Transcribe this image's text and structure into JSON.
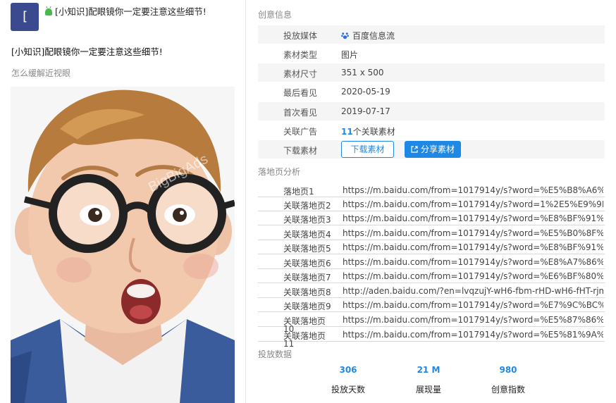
{
  "left": {
    "avatar_char": "[",
    "header_title": "[小知识]配眼镜你一定要注意这些细节!",
    "ad_title": "[小知识]配眼镜你一定要注意这些细节!",
    "ad_desc": "怎么缓解近视眼",
    "watermark": "BigBigAds"
  },
  "creative_info": {
    "section_title": "创意信息",
    "rows": [
      {
        "label": "投放媒体",
        "value": "百度信息流"
      },
      {
        "label": "素材类型",
        "value": "图片"
      },
      {
        "label": "素材尺寸",
        "value": "351 x 500"
      },
      {
        "label": "最后看见",
        "value": "2020-05-19"
      },
      {
        "label": "首次看见",
        "value": "2019-07-17"
      },
      {
        "label": "关联广告",
        "count": "11",
        "suffix": "个关联素材"
      },
      {
        "label": "下载素材"
      }
    ],
    "download_button": "下载素材",
    "share_button": "分享素材"
  },
  "landing": {
    "section_title": "落地页分析",
    "rows": [
      {
        "label": "落地页1",
        "url": "https://m.baidu.com/from=1017914y/s?word=%E5%B8%A6%E7%8..."
      },
      {
        "label": "关联落地页2",
        "url": "https://m.baidu.com/from=1017914y/s?word=1%2E5%E9%9D%92..."
      },
      {
        "label": "关联落地页3",
        "url": "https://m.baidu.com/from=1017914y/s?word=%E8%BF%91%E8%A..."
      },
      {
        "label": "关联落地页4",
        "url": "https://m.baidu.com/from=1017914y/s?word=%E5%B0%8F%E5%A..."
      },
      {
        "label": "关联落地页5",
        "url": "https://m.baidu.com/from=1017914y/s?word=%E8%BF%91%E8%A..."
      },
      {
        "label": "关联落地页6",
        "url": "https://m.baidu.com/from=1017914y/s?word=%E8%A7%86%E5%8..."
      },
      {
        "label": "关联落地页7",
        "url": "https://m.baidu.com/from=1017914y/s?word=%E6%BF%80%E5%8..."
      },
      {
        "label": "关联落地页8",
        "url": "http://aden.baidu.com/?en=lvqzujY-wH6-fbm-rHD-wH6-fHT-rjm-wH..."
      },
      {
        "label": "关联落地页9",
        "url": "https://m.baidu.com/from=1017914y/s?word=%E7%9C%BC%E9%9..."
      },
      {
        "label": "关联落地页",
        "sub": "10",
        "url": "https://m.baidu.com/from=1017914y/s?word=%E5%87%86%E5%8..."
      },
      {
        "label": "关联落地页",
        "sub": "11",
        "url": "https://m.baidu.com/from=1017914y/s?word=%E5%81%9A%E6%B..."
      }
    ]
  },
  "stats": {
    "section_title": "投放数据",
    "items": [
      {
        "value": "306",
        "label": "投放天数"
      },
      {
        "value": "21 M",
        "label": "展现量"
      },
      {
        "value": "980",
        "label": "创意指数"
      }
    ]
  },
  "colors": {
    "accent": "#1e88e5",
    "avatar_bg": "#3b4a8f",
    "row_shade": "#f5f5f5"
  }
}
